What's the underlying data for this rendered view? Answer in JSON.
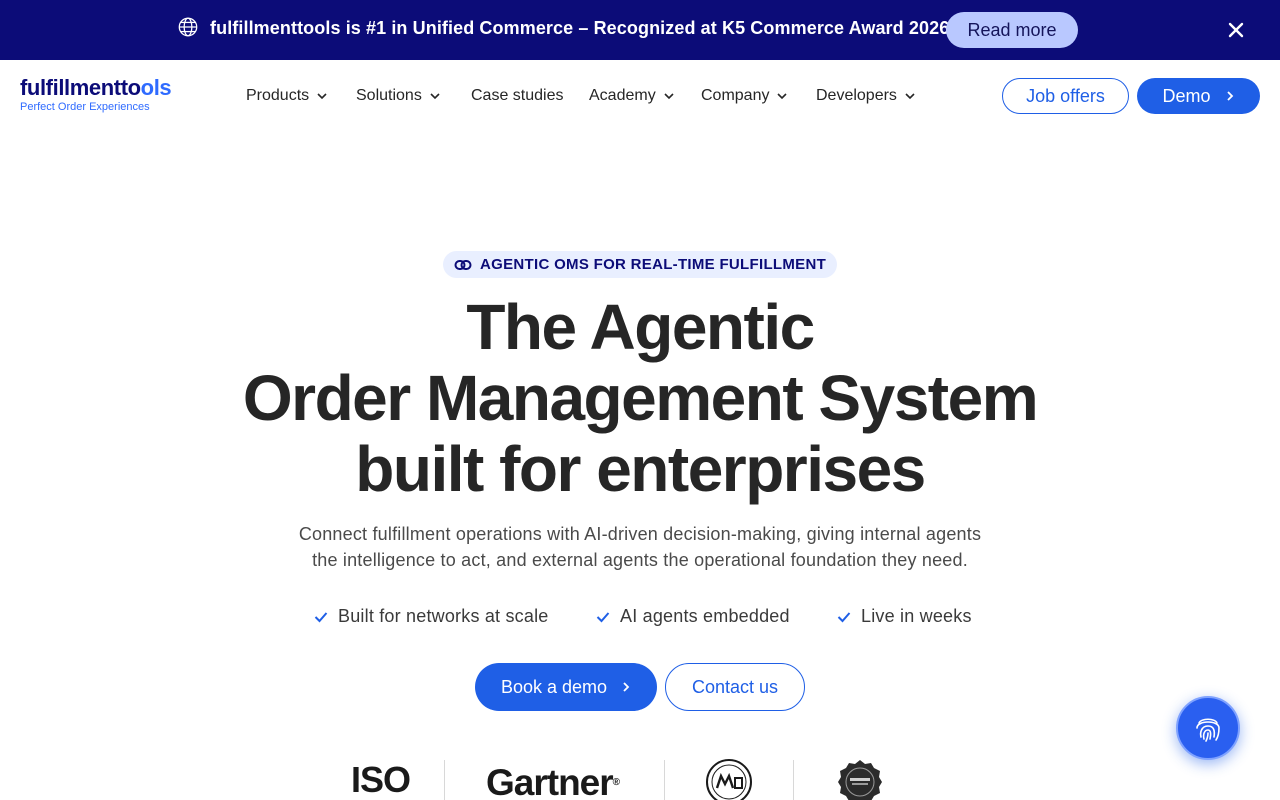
{
  "announcement": {
    "icon": "globe-icon",
    "message": "fulfillmenttools is #1 in Unified Commerce – Recognized at K5 Commerce Award 2026",
    "cta_label": "Read more",
    "close_icon": "close-icon",
    "background": "#0c0c78"
  },
  "header": {
    "logo": {
      "word_main": "fulfillmentto",
      "word_accent": "ols",
      "tagline": "Perfect Order Experiences"
    },
    "nav": [
      {
        "label": "Products",
        "has_dropdown": true
      },
      {
        "label": "Solutions",
        "has_dropdown": true
      },
      {
        "label": "Case studies",
        "has_dropdown": false
      },
      {
        "label": "Academy",
        "has_dropdown": true
      },
      {
        "label": "Company",
        "has_dropdown": true
      },
      {
        "label": "Developers",
        "has_dropdown": true
      }
    ],
    "job_offers_label": "Job offers",
    "demo_label": "Demo"
  },
  "hero": {
    "eyebrow": "AGENTIC OMS FOR REAL-TIME FULFILLMENT",
    "title_lines": [
      "The Agentic",
      "Order Management System",
      "built for enterprises"
    ],
    "subtitle_lines": [
      "Connect fulfillment operations with AI-driven decision-making, giving internal agents",
      "the intelligence to act, and external agents the operational foundation they need."
    ],
    "features": [
      "Built for networks at scale",
      "AI agents embedded",
      "Live in weeks"
    ],
    "primary_cta": "Book a demo",
    "secondary_cta": "Contact us"
  },
  "trust_logos": {
    "iso": "ISO",
    "gartner": "Gartner",
    "gartner_mark": "®",
    "mach_badge": "mach-member-badge",
    "k5_badge": "k5-commerce-award-badge"
  },
  "chat_button_icon": "fingerprint-icon",
  "colors": {
    "brand_navy": "#0c0c78",
    "brand_blue": "#1f5fe6",
    "pill_bg": "#e9efff"
  }
}
